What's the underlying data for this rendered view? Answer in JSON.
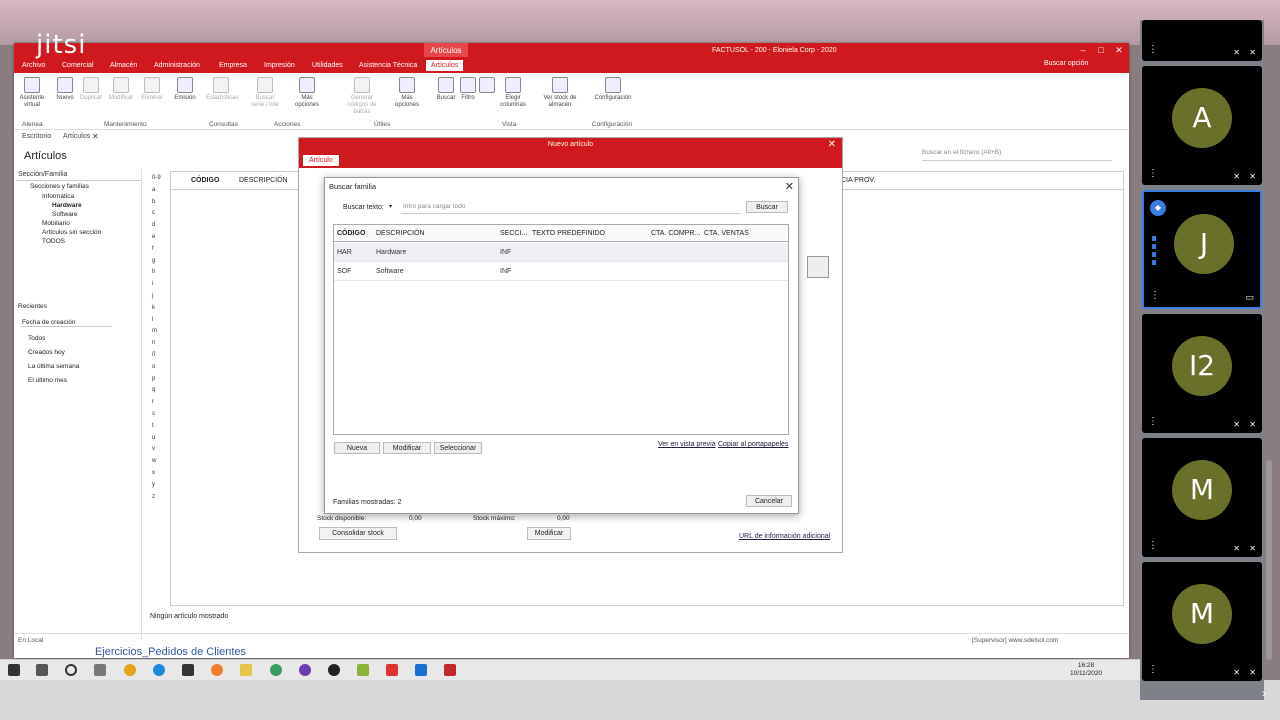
{
  "jitsi": {
    "logo": "jitsi"
  },
  "app": {
    "window_title": "FACTUSOL - 200 - Eloniela Corp - 2020",
    "contextual_tab": "Artículos",
    "menu": [
      "Archivo",
      "Comercial",
      "Almacén",
      "Administración",
      "Empresa",
      "Impresión",
      "Utilidades",
      "Asistencia Técnica",
      "Artículos"
    ],
    "search_option": "Buscar opción",
    "ribbon": {
      "buttons": [
        "Asistente virtual",
        "Nuevo",
        "Duplicar",
        "Modificar",
        "Eliminar",
        "Emisión",
        "Estadísticas",
        "Buscar serie / lote",
        "Más opciones",
        "Generar códigos de barras",
        "Más opciones",
        "Buscar",
        "Filtro",
        "",
        "Elegir columnas",
        "Ver stock de almacén",
        "Configuración"
      ],
      "groups": [
        "Atenea",
        "Mantenimiento",
        "Consultas",
        "Acciones",
        "Útiles",
        "Vista",
        "Configuración"
      ]
    },
    "doc_tabs": [
      "Escritorio",
      "Artículos"
    ],
    "page_title": "Artículos",
    "search_file": "Buscar en el fichero (Alt+B)",
    "left_pane": {
      "header": "Sección/Familia",
      "tree": [
        "Secciones y familias",
        "Informática",
        "Hardware",
        "Software",
        "Mobiliario",
        "Artículos sin sección",
        "TODOS"
      ],
      "recent_header": "Recientes",
      "recent_select": "Fecha de creación",
      "radios": [
        "Todos",
        "Creados hoy",
        "La última semana",
        "El último mes"
      ]
    },
    "letters": [
      "0-9",
      "a",
      "b",
      "c",
      "d",
      "e",
      "f",
      "g",
      "h",
      "i",
      "j",
      "k",
      "l",
      "m",
      "n",
      "ñ",
      "o",
      "p",
      "q",
      "r",
      "s",
      "t",
      "u",
      "v",
      "w",
      "x",
      "y",
      "z"
    ],
    "grid_headers": [
      "CÓDIGO",
      "DESCRIPCIÓN",
      "CIA PROV."
    ],
    "status": "Ningún artículo mostrado",
    "footer_left": "En Local",
    "footer_right": "[Supervisor]  www.sdelsol.com"
  },
  "nuevo_articulo": {
    "title": "Nuevo artículo",
    "tab": "Artículo",
    "consolidar": "Consolidar stock",
    "modificar": "Modificar",
    "url_link": "URL de información adicional",
    "stock_disp_label": "Stock disponible:",
    "stock_max_label": "Stock máximo:",
    "stock_disp": "0,00",
    "stock_max": "0,00"
  },
  "dialog": {
    "title": "Buscar familia",
    "search_label": "Buscar texto:",
    "placeholder": "Intro para cargar todo",
    "search_button": "Buscar",
    "columns": [
      "CÓDIGO",
      "DESCRIPCIÓN",
      "SECCI...",
      "TEXTO PREDEFINIDO",
      "CTA. COMPR...",
      "CTA. VENTAS"
    ],
    "rows": [
      {
        "codigo": "HAR",
        "descripcion": "Hardware",
        "seccion": "INF"
      },
      {
        "codigo": "SOF",
        "descripcion": "Software",
        "seccion": "INF"
      }
    ],
    "buttons": {
      "nueva": "Nueva",
      "modificar": "Modificar",
      "seleccionar": "Seleccionar",
      "cancelar": "Cancelar"
    },
    "links": {
      "preview": "Ver en vista previa",
      "copy": "Copiar al portapapeles"
    },
    "count": "Familias mostradas:  2"
  },
  "taskbar": {
    "time": "16:28",
    "date": "10/11/2020",
    "behind_text": "Ejercicios_Pedidos de Clientes"
  },
  "participants": [
    {
      "initial": "",
      "active": false
    },
    {
      "initial": "A",
      "active": false
    },
    {
      "initial": "J",
      "active": true
    },
    {
      "initial": "I2",
      "active": false
    },
    {
      "initial": "M",
      "active": false
    },
    {
      "initial": "M",
      "active": false
    }
  ],
  "colors": {
    "brand_red": "#d0191f",
    "avatar": "#69702a",
    "active_border": "#3c7be0"
  }
}
